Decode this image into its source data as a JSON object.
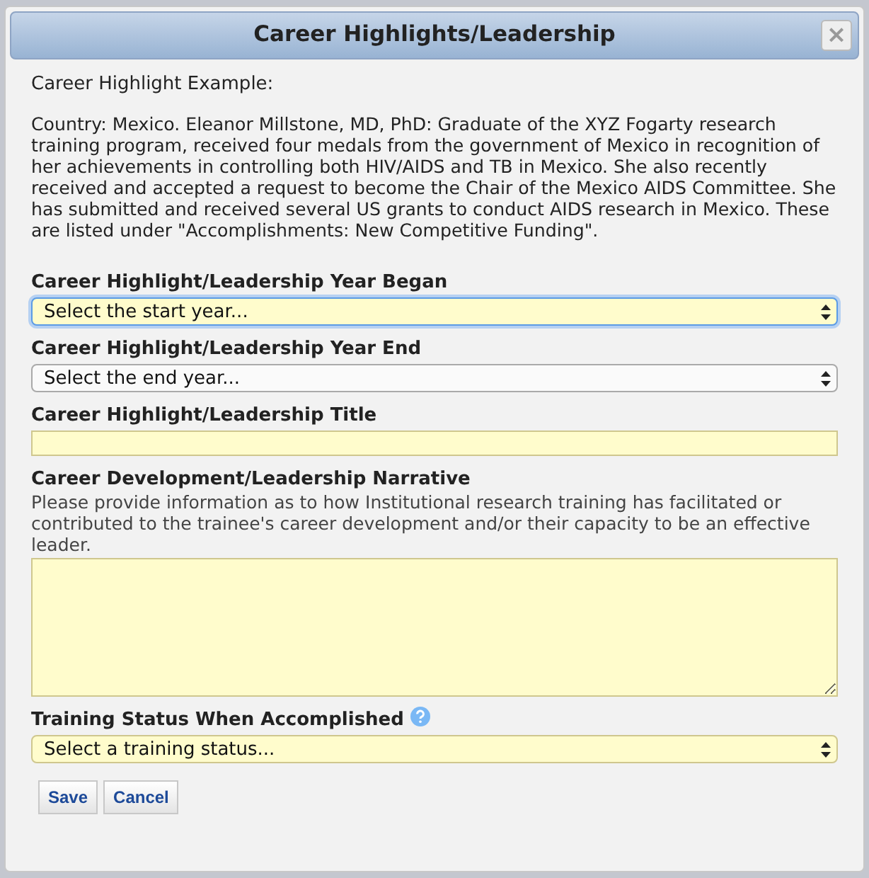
{
  "dialog": {
    "title": "Career Highlights/Leadership",
    "close_label": "×"
  },
  "intro": "Career Highlight Example:",
  "example": "Country: Mexico. Eleanor Millstone, MD, PhD: Graduate of the XYZ Fogarty research training program, received four medals from the government of Mexico in recognition of her achievements in controlling both HIV/AIDS and TB in Mexico. She also recently received and accepted a request to become the Chair of the Mexico AIDS Committee. She has submitted and received several US grants to conduct AIDS research in Mexico. These are listed under \"Accomplishments: New Competitive Funding\".",
  "fields": [
    {
      "kind": "select",
      "label": "Career Highlight/Leadership Year Began",
      "value": "Select the start year...",
      "required": true,
      "focused": true
    },
    {
      "kind": "select",
      "label": "Career Highlight/Leadership Year End",
      "value": "Select the end year...",
      "required": false,
      "focused": false
    },
    {
      "kind": "text",
      "label": "Career Highlight/Leadership Title",
      "required": true,
      "focused": false
    },
    {
      "kind": "textarea",
      "label": "Career Development/Leadership Narrative",
      "help": "Please provide information as to how Institutional research training has facilitated or contributed to the trainee's career development and/or their capacity to be an effective leader.",
      "required": true,
      "focused": false
    },
    {
      "kind": "select",
      "label": "Training Status When Accomplished",
      "info": true,
      "value": "Select a training status...",
      "required": true,
      "focused": false
    }
  ],
  "buttons": [
    "Save",
    "Cancel"
  ]
}
